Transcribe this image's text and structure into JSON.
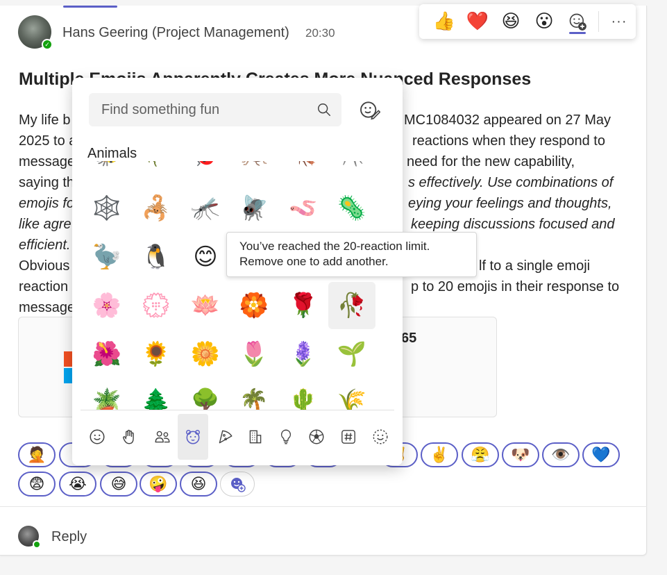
{
  "message": {
    "author": "Hans Geering (Project Management)",
    "time": "20:30",
    "title": "Multiple Emojis Apparently Creates More Nuanced Responses",
    "lines": [
      {
        "left": "My life b",
        "right": "MC1084032 appeared on 27 May"
      },
      {
        "left": "2025 to a",
        "right": "reactions when they respond to"
      },
      {
        "left": "message",
        "right": "need for the new capability,"
      },
      {
        "left": "saying th",
        "right": "s effectively. Use combinations of"
      },
      {
        "left": "emojis fo",
        "right": "eying your feelings and thoughts,"
      },
      {
        "left": "like agre",
        "right": "keeping discussions focused and"
      },
      {
        "left": "efficient.",
        "right": ""
      },
      {
        "left": "Obvious",
        "right": "lf to a single emoji"
      },
      {
        "left": "reaction",
        "right": "p to 20 emojis in their response to"
      },
      {
        "left": "message",
        "right": ""
      }
    ],
    "card_title_fragment": "65",
    "reply_label": "Reply"
  },
  "reaction_bar": {
    "quick_reactions": [
      "👍",
      "❤️",
      "😆",
      "😮"
    ],
    "more_reactions_icon": "emoji-add-icon",
    "more_options": "···"
  },
  "reactions": {
    "row1": [
      "🤦",
      "🤞",
      "🙏",
      "😂",
      "🎉",
      "👏",
      "😎",
      "😡",
      "✌️",
      "😤",
      "🐶",
      "👁️",
      "💙"
    ],
    "row2": [
      "😨",
      "😭",
      "😅",
      "🤪",
      "😆"
    ]
  },
  "picker": {
    "search_placeholder": "Find something fun",
    "section": "Animals",
    "rows": [
      [
        "🐝",
        "🪲",
        "🐞",
        "🦗",
        "🪳",
        "🕷️"
      ],
      [
        "🕸️",
        "🦂",
        "🦟",
        "🪰",
        "🪱",
        "🦠"
      ],
      [
        "🦤",
        "🐧",
        "😊",
        "",
        "",
        ""
      ],
      [
        "🌸",
        "💮",
        "🪷",
        "🏵️",
        "🌹",
        "🥀"
      ],
      [
        "🌺",
        "🌻",
        "🌼",
        "🌷",
        "🪻",
        "🌱"
      ],
      [
        "🪴",
        "🌲",
        "🌳",
        "🌴",
        "🌵",
        "🌾"
      ]
    ],
    "tooltip_line1": "You’ve reached the 20-reaction limit.",
    "tooltip_line2": "Remove one to add another.",
    "categories": [
      "smiley",
      "hand",
      "people",
      "animals",
      "food",
      "building",
      "lightbulb",
      "ball",
      "hashtag",
      "dashed-smiley"
    ],
    "accent_color": "#5b5fc7"
  }
}
